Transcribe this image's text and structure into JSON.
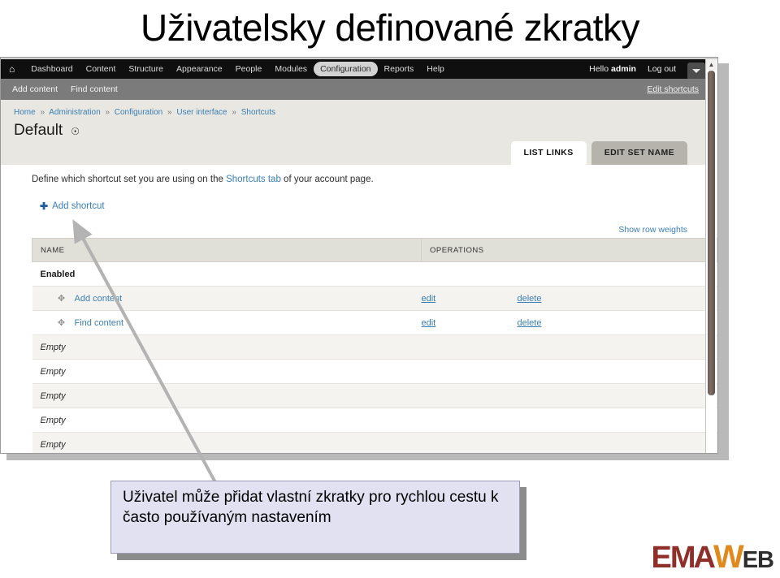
{
  "slide": {
    "title": "Uživatelsky definované zkratky"
  },
  "browser": {
    "toolbar": {
      "home_icon": "home-icon",
      "items": [
        {
          "label": "Dashboard",
          "active": false
        },
        {
          "label": "Content",
          "active": false
        },
        {
          "label": "Structure",
          "active": false
        },
        {
          "label": "Appearance",
          "active": false
        },
        {
          "label": "People",
          "active": false
        },
        {
          "label": "Modules",
          "active": false
        },
        {
          "label": "Configuration",
          "active": true
        },
        {
          "label": "Reports",
          "active": false
        },
        {
          "label": "Help",
          "active": false
        }
      ],
      "hello_prefix": "Hello ",
      "hello_user": "admin",
      "logout_label": "Log out",
      "drawer_toggle_icon": "chevron-down-icon"
    },
    "drawer": {
      "links": [
        {
          "label": "Add content"
        },
        {
          "label": "Find content"
        }
      ],
      "edit_label": "Edit shortcuts"
    },
    "breadcrumb": {
      "separator": "»",
      "items": [
        {
          "label": "Home"
        },
        {
          "label": "Administration"
        },
        {
          "label": "Configuration"
        },
        {
          "label": "User interface"
        },
        {
          "label": "Shortcuts"
        }
      ]
    },
    "page": {
      "title": "Default",
      "title_icon": "gear-icon",
      "tabs": [
        {
          "label": "LIST LINKS",
          "active": true
        },
        {
          "label": "EDIT SET NAME",
          "active": false
        }
      ],
      "description_before": "Define which shortcut set you are using on the ",
      "description_link": "Shortcuts tab",
      "description_after": " of your account page.",
      "add_shortcut_label": "Add shortcut",
      "add_shortcut_icon": "plus-icon",
      "show_row_weights_label": "Show row weights"
    },
    "table": {
      "columns": [
        {
          "label": "NAME"
        },
        {
          "label": "OPERATIONS"
        }
      ],
      "group_label": "Enabled",
      "rows": [
        {
          "name": "Add content",
          "type": "link",
          "drag_icon": "move-icon",
          "edit": "edit",
          "delete": "delete"
        },
        {
          "name": "Find content",
          "type": "link",
          "drag_icon": "move-icon",
          "edit": "edit",
          "delete": "delete"
        },
        {
          "name": "Empty",
          "type": "empty",
          "edit": "",
          "delete": ""
        },
        {
          "name": "Empty",
          "type": "empty",
          "edit": "",
          "delete": ""
        },
        {
          "name": "Empty",
          "type": "empty",
          "edit": "",
          "delete": ""
        },
        {
          "name": "Empty",
          "type": "empty",
          "edit": "",
          "delete": ""
        },
        {
          "name": "Empty",
          "type": "empty",
          "edit": "",
          "delete": ""
        }
      ]
    },
    "scrollbar": {
      "up_arrow_icon": "chevron-up-icon"
    },
    "cursor_icon": "mouse-pointer-icon"
  },
  "callout": {
    "text": "Uživatel může přidat vlastní zkratky pro rychlou cestu k často používaným nastavením"
  },
  "logo": {
    "part1": "E",
    "part2": "MA",
    "part3": "W",
    "part4": "EB"
  },
  "colors": {
    "toolbar_bg": "#0f0f0f",
    "drawer_bg": "#7b7b7b",
    "header_bg": "#e8e7e1",
    "link_blue": "#3b7fb5",
    "callout_bg": "#e1e1f2",
    "logo_red": "#8f2f2a",
    "logo_orange": "#e08a1e",
    "logo_dark": "#2e2e2e"
  }
}
